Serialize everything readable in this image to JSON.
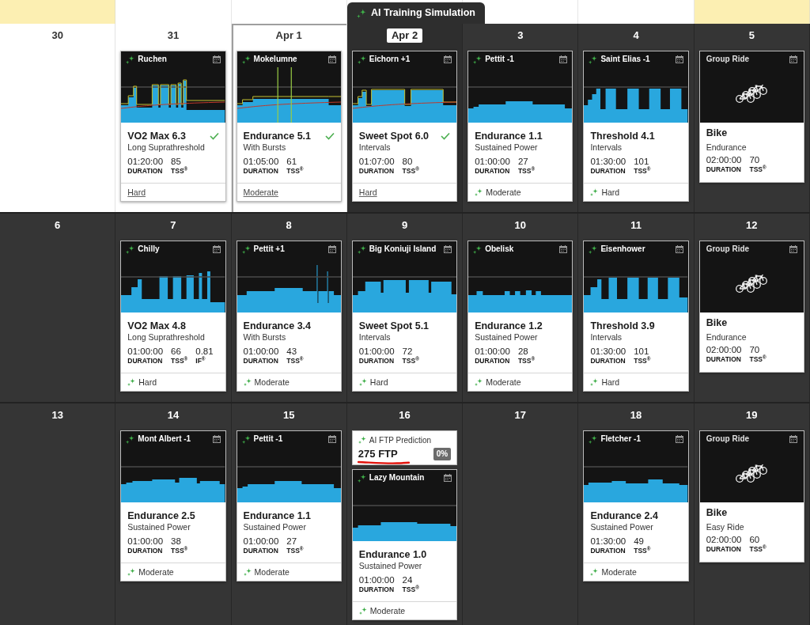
{
  "top_strip": [
    {
      "weekend": true
    },
    {
      "weekend": false
    },
    {
      "weekend": false
    },
    {
      "weekend": false
    },
    {
      "weekend": false
    },
    {
      "weekend": false
    },
    {
      "weekend": true
    }
  ],
  "simulation_tab": {
    "label": "AI Training Simulation"
  },
  "weeks": [
    {
      "days": [
        {
          "date": "30",
          "past": true,
          "today": false,
          "highlighted": false
        },
        {
          "date": "31",
          "past": true,
          "today": false,
          "highlighted": false,
          "items": [
            {
              "kind": "workout",
              "name": "Ruchen",
              "title": "VO2 Max 6.3",
              "subtitle": "Long Suprathreshold",
              "completed": true,
              "stats": [
                {
                  "value": "01:20:00",
                  "label": "DURATION"
                },
                {
                  "value": "85",
                  "label": "TSS$^{®}$"
                }
              ],
              "intensity": "Hard"
            }
          ]
        },
        {
          "date": "Apr 1",
          "past": true,
          "today": true,
          "highlighted": false,
          "items": [
            {
              "kind": "workout",
              "name": "Mokelumne",
              "title": "Endurance 5.1",
              "subtitle": "With Bursts",
              "completed": true,
              "stats": [
                {
                  "value": "01:05:00",
                  "label": "DURATION"
                },
                {
                  "value": "61",
                  "label": "TSS$^{®}$"
                }
              ],
              "intensity": "Moderate"
            }
          ]
        },
        {
          "date": "Apr 2",
          "past": false,
          "today": false,
          "highlighted": true,
          "items": [
            {
              "kind": "workout",
              "name": "Eichorn +1",
              "title": "Sweet Spot 6.0",
              "subtitle": "Intervals",
              "completed": true,
              "stats": [
                {
                  "value": "01:07:00",
                  "label": "DURATION"
                },
                {
                  "value": "80",
                  "label": "TSS$^{®}$"
                }
              ],
              "intensity": "Hard"
            }
          ]
        },
        {
          "date": "3",
          "past": false,
          "today": false,
          "highlighted": false,
          "items": [
            {
              "kind": "workout",
              "name": "Pettit -1",
              "title": "Endurance 1.1",
              "subtitle": "Sustained Power",
              "completed": false,
              "stats": [
                {
                  "value": "01:00:00",
                  "label": "DURATION"
                },
                {
                  "value": "27",
                  "label": "TSS$^{®}$"
                }
              ],
              "intensity": "Moderate"
            }
          ]
        },
        {
          "date": "4",
          "past": false,
          "today": false,
          "highlighted": false,
          "items": [
            {
              "kind": "workout",
              "name": "Saint Elias -1",
              "title": "Threshold 4.1",
              "subtitle": "Intervals",
              "completed": false,
              "stats": [
                {
                  "value": "01:30:00",
                  "label": "DURATION"
                },
                {
                  "value": "101",
                  "label": "TSS$^{®}$"
                }
              ],
              "intensity": "Hard"
            }
          ]
        },
        {
          "date": "5",
          "past": false,
          "today": false,
          "highlighted": false,
          "items": [
            {
              "kind": "group_ride",
              "name": "Group Ride",
              "title": "Bike",
              "subtitle": "Endurance",
              "stats": [
                {
                  "value": "02:00:00",
                  "label": "DURATION"
                },
                {
                  "value": "70",
                  "label": "TSS$^{®}$"
                }
              ]
            }
          ]
        }
      ]
    },
    {
      "days": [
        {
          "date": "6",
          "past": false,
          "today": false,
          "highlighted": false
        },
        {
          "date": "7",
          "past": false,
          "today": false,
          "highlighted": false,
          "items": [
            {
              "kind": "workout",
              "name": "Chilly",
              "title": "VO2 Max 4.8",
              "subtitle": "Long Suprathreshold",
              "completed": false,
              "stats": [
                {
                  "value": "01:00:00",
                  "label": "DURATION"
                },
                {
                  "value": "66",
                  "label": "TSS$^{®}$"
                },
                {
                  "value": "0.81",
                  "label": "IF$^{®}$"
                }
              ],
              "intensity": "Hard"
            }
          ]
        },
        {
          "date": "8",
          "past": false,
          "today": false,
          "highlighted": false,
          "items": [
            {
              "kind": "workout",
              "name": "Pettit +1",
              "title": "Endurance 3.4",
              "subtitle": "With Bursts",
              "completed": false,
              "stats": [
                {
                  "value": "01:00:00",
                  "label": "DURATION"
                },
                {
                  "value": "43",
                  "label": "TSS$^{®}$"
                }
              ],
              "intensity": "Moderate"
            }
          ]
        },
        {
          "date": "9",
          "past": false,
          "today": false,
          "highlighted": false,
          "items": [
            {
              "kind": "workout",
              "name": "Big Koniuji Island",
              "title": "Sweet Spot 5.1",
              "subtitle": "Intervals",
              "completed": false,
              "stats": [
                {
                  "value": "01:00:00",
                  "label": "DURATION"
                },
                {
                  "value": "72",
                  "label": "TSS$^{®}$"
                }
              ],
              "intensity": "Hard"
            }
          ]
        },
        {
          "date": "10",
          "past": false,
          "today": false,
          "highlighted": false,
          "items": [
            {
              "kind": "workout",
              "name": "Obelisk",
              "title": "Endurance 1.2",
              "subtitle": "Sustained Power",
              "completed": false,
              "stats": [
                {
                  "value": "01:00:00",
                  "label": "DURATION"
                },
                {
                  "value": "28",
                  "label": "TSS$^{®}$"
                }
              ],
              "intensity": "Moderate"
            }
          ]
        },
        {
          "date": "11",
          "past": false,
          "today": false,
          "highlighted": false,
          "items": [
            {
              "kind": "workout",
              "name": "Eisenhower",
              "title": "Threshold 3.9",
              "subtitle": "Intervals",
              "completed": false,
              "stats": [
                {
                  "value": "01:30:00",
                  "label": "DURATION"
                },
                {
                  "value": "101",
                  "label": "TSS$^{®}$"
                }
              ],
              "intensity": "Hard"
            }
          ]
        },
        {
          "date": "12",
          "past": false,
          "today": false,
          "highlighted": false,
          "items": [
            {
              "kind": "group_ride",
              "name": "Group Ride",
              "title": "Bike",
              "subtitle": "Endurance",
              "stats": [
                {
                  "value": "02:00:00",
                  "label": "DURATION"
                },
                {
                  "value": "70",
                  "label": "TSS$^{®}$"
                }
              ]
            }
          ]
        }
      ]
    },
    {
      "days": [
        {
          "date": "13",
          "past": false,
          "today": false,
          "highlighted": false
        },
        {
          "date": "14",
          "past": false,
          "today": false,
          "highlighted": false,
          "items": [
            {
              "kind": "workout",
              "name": "Mont Albert -1",
              "title": "Endurance 2.5",
              "subtitle": "Sustained Power",
              "completed": false,
              "stats": [
                {
                  "value": "01:00:00",
                  "label": "DURATION"
                },
                {
                  "value": "38",
                  "label": "TSS$^{®}$"
                }
              ],
              "intensity": "Moderate"
            }
          ]
        },
        {
          "date": "15",
          "past": false,
          "today": false,
          "highlighted": false,
          "items": [
            {
              "kind": "workout",
              "name": "Pettit -1",
              "title": "Endurance 1.1",
              "subtitle": "Sustained Power",
              "completed": false,
              "stats": [
                {
                  "value": "01:00:00",
                  "label": "DURATION"
                },
                {
                  "value": "27",
                  "label": "TSS$^{®}$"
                }
              ],
              "intensity": "Moderate"
            }
          ]
        },
        {
          "date": "16",
          "past": false,
          "today": false,
          "highlighted": false,
          "items": [
            {
              "kind": "ftp_prediction",
              "label": "AI FTP Prediction",
              "value": "275 FTP",
              "change": "0%",
              "underlined": true
            },
            {
              "kind": "workout",
              "name": "Lazy Mountain",
              "title": "Endurance 1.0",
              "subtitle": "Sustained Power",
              "completed": false,
              "stats": [
                {
                  "value": "01:00:00",
                  "label": "DURATION"
                },
                {
                  "value": "24",
                  "label": "TSS$^{®}$"
                }
              ],
              "intensity": "Moderate"
            }
          ]
        },
        {
          "date": "17",
          "past": false,
          "today": false,
          "highlighted": false
        },
        {
          "date": "18",
          "past": false,
          "today": false,
          "highlighted": false,
          "items": [
            {
              "kind": "workout",
              "name": "Fletcher -1",
              "title": "Endurance 2.4",
              "subtitle": "Sustained Power",
              "completed": false,
              "stats": [
                {
                  "value": "01:30:00",
                  "label": "DURATION"
                },
                {
                  "value": "49",
                  "label": "TSS$^{®}$"
                }
              ],
              "intensity": "Moderate"
            }
          ]
        },
        {
          "date": "19",
          "past": false,
          "today": false,
          "highlighted": false,
          "items": [
            {
              "kind": "group_ride",
              "name": "Group Ride",
              "title": "Bike",
              "subtitle": "Easy Ride",
              "stats": [
                {
                  "value": "02:00:00",
                  "label": "DURATION"
                },
                {
                  "value": "60",
                  "label": "TSS$^{®}$"
                }
              ]
            }
          ]
        }
      ]
    }
  ]
}
